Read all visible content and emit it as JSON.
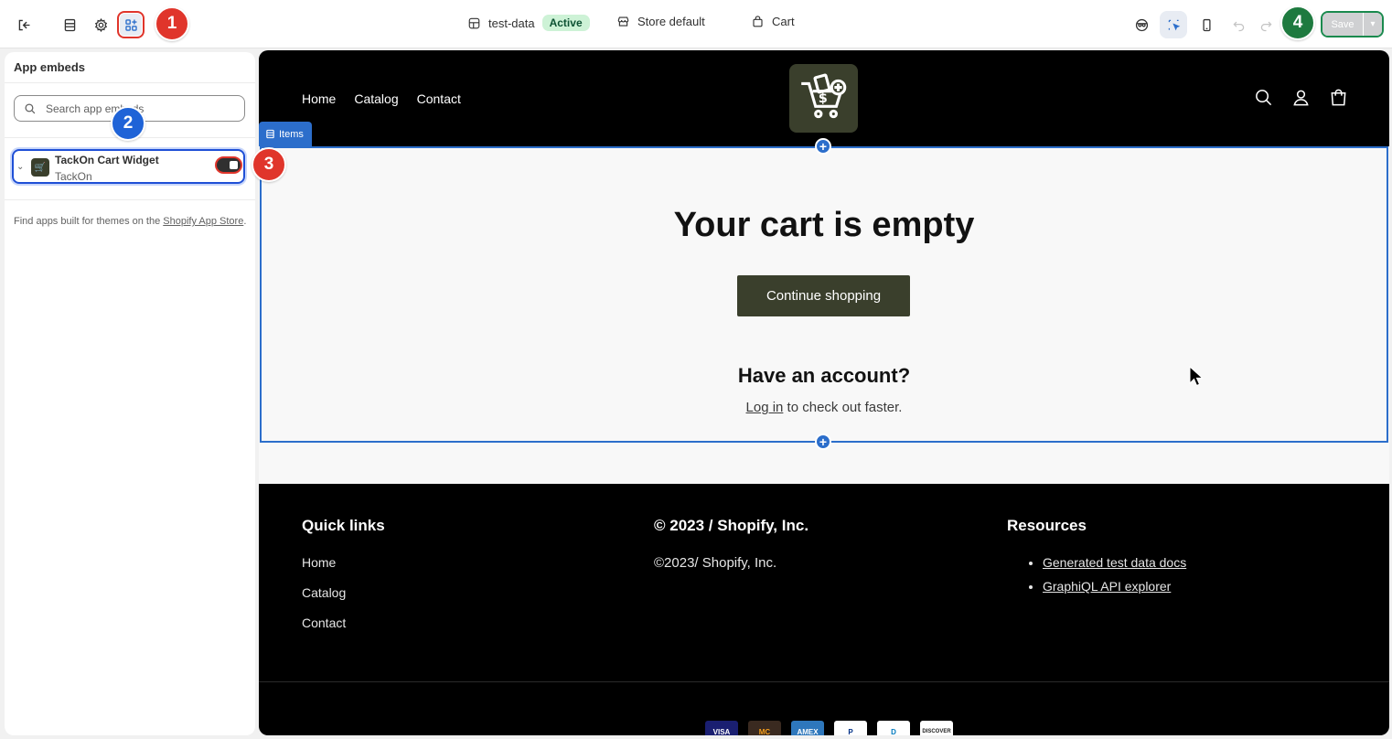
{
  "topbar": {
    "theme_name": "test-data",
    "theme_status": "Active",
    "store_context": "Store default",
    "page_context": "Cart",
    "save_label": "Save"
  },
  "callouts": [
    "1",
    "2",
    "3",
    "4"
  ],
  "panel": {
    "title": "App embeds",
    "search_placeholder": "Search app embeds",
    "embed": {
      "name": "TackOn Cart Widget",
      "provider": "TackOn",
      "enabled": true
    },
    "find_apps_text": "Find apps built for themes on the ",
    "find_apps_link": "Shopify App Store",
    "find_apps_end": "."
  },
  "store": {
    "nav": [
      "Home",
      "Catalog",
      "Contact"
    ],
    "section_tag": "Items",
    "cart_title": "Your cart is empty",
    "continue_label": "Continue shopping",
    "account_title": "Have an account?",
    "login_link": "Log in",
    "login_rest": " to check out faster."
  },
  "footer": {
    "quick_links_title": "Quick links",
    "quick_links": [
      "Home",
      "Catalog",
      "Contact"
    ],
    "copyright_title": "© 2023 / Shopify, Inc.",
    "copyright_text": "©2023/ Shopify, Inc.",
    "resources_title": "Resources",
    "resources": [
      "Generated test data docs",
      "GraphiQL API explorer"
    ],
    "payments": [
      "VISA",
      "MC",
      "AMEX",
      "P",
      "D",
      "DISCOVER"
    ]
  },
  "colors": {
    "accent_blue": "#2c6ecb",
    "callout_red": "#e0352b",
    "callout_blue": "#1f63d7",
    "callout_green": "#1e7a3f",
    "brand_olive": "#3a3f2c"
  }
}
